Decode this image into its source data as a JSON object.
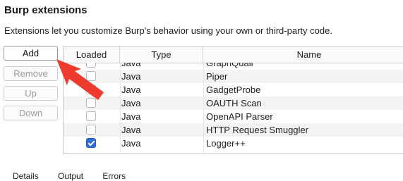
{
  "header": {
    "title": "Burp extensions",
    "description": "Extensions let you customize Burp's behavior using your own or third-party code."
  },
  "buttons": {
    "add": "Add",
    "remove": "Remove",
    "up": "Up",
    "down": "Down"
  },
  "table": {
    "columns": {
      "loaded": "Loaded",
      "type": "Type",
      "name": "Name"
    },
    "rows": [
      {
        "loaded": false,
        "type": "Java",
        "name": "GraphQuail"
      },
      {
        "loaded": false,
        "type": "Java",
        "name": "Piper"
      },
      {
        "loaded": false,
        "type": "Java",
        "name": "GadgetProbe"
      },
      {
        "loaded": false,
        "type": "Java",
        "name": "OAUTH Scan"
      },
      {
        "loaded": false,
        "type": "Java",
        "name": "OpenAPI Parser"
      },
      {
        "loaded": false,
        "type": "Java",
        "name": "HTTP Request Smuggler"
      },
      {
        "loaded": true,
        "type": "Java",
        "name": "Logger++"
      }
    ]
  },
  "bottom_tabs": [
    "Details",
    "Output",
    "Errors"
  ],
  "colors": {
    "accent": "#2f6fd6",
    "arrow": "#ee3b2d"
  }
}
